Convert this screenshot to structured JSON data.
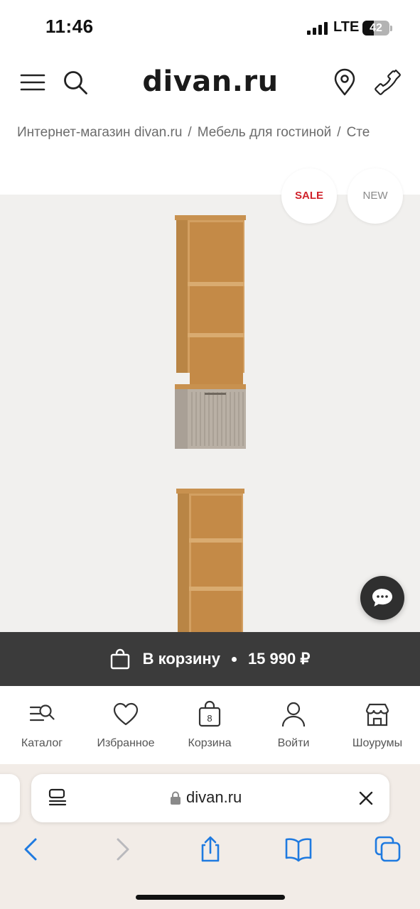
{
  "status_bar": {
    "time": "11:46",
    "network": "LTE",
    "battery": "42",
    "battery_level": 0.42,
    "icons": [
      "signal-bars-icon",
      "battery-icon"
    ]
  },
  "header": {
    "logo": "divan.ru",
    "icons": [
      "menu-icon",
      "search-icon",
      "location-pin-icon",
      "phone-icon"
    ]
  },
  "breadcrumb": {
    "items": [
      "Интернет-магазин divan.ru",
      "Мебель для гостиной",
      "Сте"
    ],
    "separator": "/"
  },
  "gallery": {
    "badges": {
      "sale": "SALE",
      "new": "NEW"
    },
    "colors": {
      "background": "#f1f0ee",
      "sale": "#d0222b",
      "oak": "#c8914f",
      "taupe": "#b9b0a5"
    },
    "images": [
      "bookcase-with-fluted-door",
      "open-bookcase"
    ]
  },
  "chat": {
    "icon": "chat-bubble-icon"
  },
  "cart_bar": {
    "label": "В корзину",
    "price": "15 990 ₽",
    "icon": "shopping-bag-icon",
    "background": "#3b3b3b"
  },
  "bottom_nav": {
    "items": [
      {
        "label": "Каталог",
        "icon": "catalog-search-icon"
      },
      {
        "label": "Избранное",
        "icon": "heart-icon"
      },
      {
        "label": "Корзина",
        "icon": "cart-bag-icon",
        "count": "8"
      },
      {
        "label": "Войти",
        "icon": "user-icon"
      },
      {
        "label": "Шоурумы",
        "icon": "showroom-store-icon"
      }
    ]
  },
  "safari": {
    "url": "divan.ru",
    "icons": [
      "reader-mode-icon",
      "lock-icon",
      "close-icon",
      "back-icon",
      "forward-icon",
      "share-icon",
      "bookmarks-icon",
      "tabs-icon"
    ]
  }
}
